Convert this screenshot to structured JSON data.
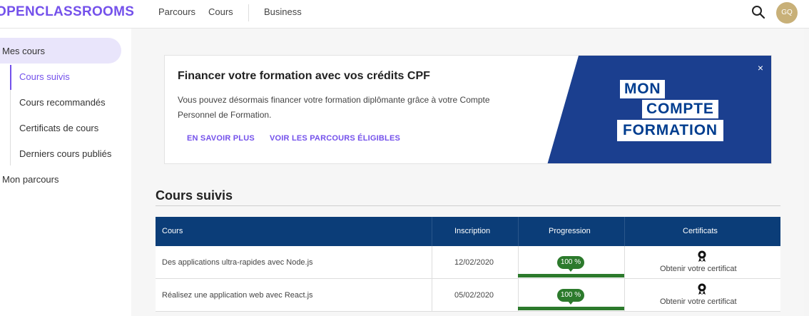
{
  "header": {
    "logo": "OPENCLASSROOMS",
    "nav": [
      "Parcours",
      "Cours",
      "Business"
    ],
    "avatar_initials": "GQ"
  },
  "sidebar": {
    "mes_cours": "Mes cours",
    "sub_items": [
      "Cours suivis",
      "Cours recommandés",
      "Certificats de cours",
      "Derniers cours publiés"
    ],
    "mon_parcours": "Mon parcours"
  },
  "banner": {
    "title": "Financer votre formation avec vos crédits CPF",
    "text": "Vous pouvez désormais financer votre formation diplômante grâce à votre Compte Personnel de Formation.",
    "link_1": "EN SAVOIR PLUS",
    "link_2": "VOIR LES PARCOURS ÉLIGIBLES",
    "logo_lines": [
      "MON",
      "COMPTE",
      "FORMATION"
    ],
    "close": "×",
    "brand_color": "#1b3f8f"
  },
  "section": {
    "title": "Cours suivis"
  },
  "table": {
    "headers": [
      "Cours",
      "Inscription",
      "Progression",
      "Certificats"
    ],
    "rows": [
      {
        "course": "Des applications ultra-rapides avec Node.js",
        "date": "12/02/2020",
        "progress_label": "100 %",
        "progress": 100,
        "certificate": "Obtenir votre certificat"
      },
      {
        "course": "Réalisez une application web avec React.js",
        "date": "05/02/2020",
        "progress_label": "100 %",
        "progress": 100,
        "certificate": "Obtenir votre certificat"
      }
    ]
  },
  "colors": {
    "accent": "#7451eb",
    "table_header": "#0b3d78",
    "progress": "#2c7a2c"
  }
}
